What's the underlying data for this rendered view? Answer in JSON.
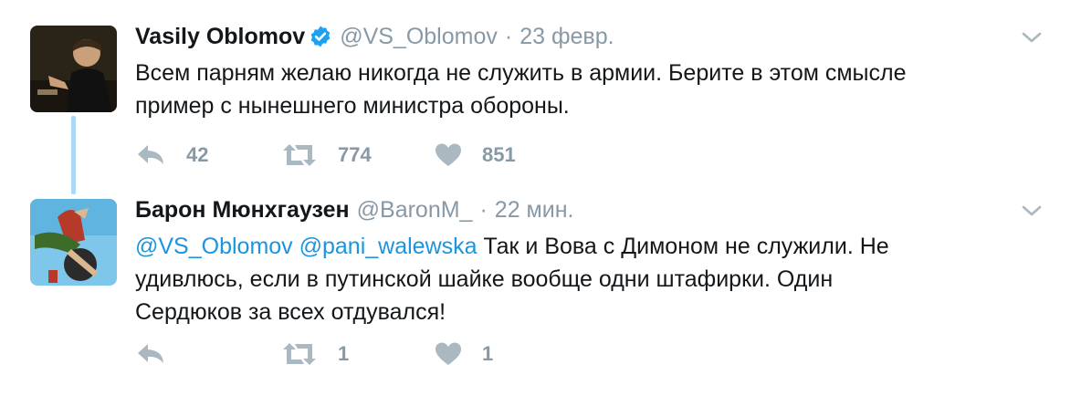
{
  "tweets": [
    {
      "fullname": "Vasily Oblomov",
      "verified": true,
      "handle": "@VS_Oblomov",
      "separator": "·",
      "time": "23 февр.",
      "text_lines": [
        "Всем парням желаю никогда не служить в армии. Берите в этом смысле",
        "пример с нынешнего министра обороны."
      ],
      "reply_count": "42",
      "retweet_count": "774",
      "like_count": "851"
    },
    {
      "fullname": "Барон Мюнхгаузен",
      "verified": false,
      "handle": "@BaronM_",
      "separator": "·",
      "time": "22 мин.",
      "mentions": [
        "@VS_Oblomov",
        "@pani_walewska"
      ],
      "text_lines": [
        "Так и Вова с Димоном не служили. Не",
        "удивлюсь, если в путинской шайке вообще одни штафирки. Один",
        "Сердюков за всех отдувался!"
      ],
      "reply_count": "",
      "retweet_count": "1",
      "like_count": "1"
    }
  ],
  "icons": {
    "reply": "reply-icon",
    "retweet": "retweet-icon",
    "like": "heart-icon",
    "caret": "chevron-down-icon",
    "verified": "verified-badge-icon"
  },
  "colors": {
    "link": "#1b95e0",
    "meta": "#8899a6",
    "text": "#14171a",
    "verified": "#1da1f2",
    "thread_line": "#a9d9f4"
  }
}
